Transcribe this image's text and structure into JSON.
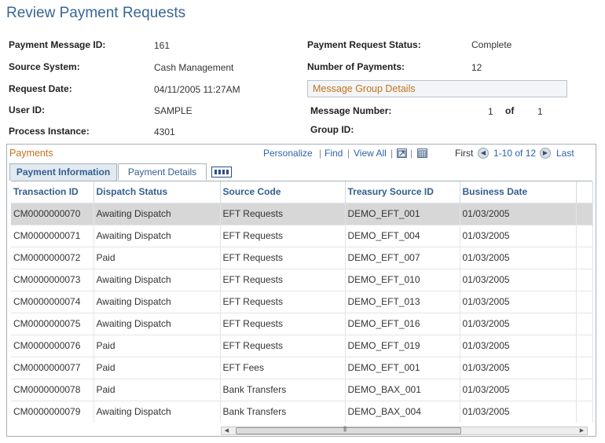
{
  "page": {
    "title": "Review Payment Requests"
  },
  "fields": {
    "payment_message_id": {
      "label": "Payment Message ID:",
      "value": "161"
    },
    "source_system": {
      "label": "Source System:",
      "value": "Cash Management"
    },
    "request_date": {
      "label": "Request Date:",
      "value": "04/11/2005 11:27AM"
    },
    "user_id": {
      "label": "User ID:",
      "value": "SAMPLE"
    },
    "process_instance": {
      "label": "Process Instance:",
      "value": "4301"
    },
    "payment_request_status": {
      "label": "Payment Request Status:",
      "value": "Complete"
    },
    "number_of_payments": {
      "label": "Number of Payments:",
      "value": "12"
    },
    "message_group_details": "Message Group Details",
    "message_number": {
      "label": "Message Number:",
      "value": "1",
      "of_label": "of",
      "of_value": "1"
    },
    "group_id": {
      "label": "Group ID:",
      "value": ""
    }
  },
  "grid": {
    "title": "Payments",
    "nav": {
      "personalize": "Personalize",
      "find": "Find",
      "view_all": "View All",
      "first": "First",
      "range": "1-10 of 12",
      "last": "Last",
      "sep": "|"
    },
    "tabs": [
      {
        "label": "Payment Information",
        "active": true
      },
      {
        "label": "Payment Details",
        "active": false
      }
    ],
    "columns": [
      "Transaction ID",
      "Dispatch Status",
      "Source Code",
      "Treasury Source ID",
      "Business Date"
    ],
    "rows": [
      [
        "CM0000000070",
        "Awaiting Dispatch",
        "EFT Requests",
        "DEMO_EFT_001",
        "01/03/2005"
      ],
      [
        "CM0000000071",
        "Awaiting Dispatch",
        "EFT Requests",
        "DEMO_EFT_004",
        "01/03/2005"
      ],
      [
        "CM0000000072",
        "Paid",
        "EFT Requests",
        "DEMO_EFT_007",
        "01/03/2005"
      ],
      [
        "CM0000000073",
        "Awaiting Dispatch",
        "EFT Requests",
        "DEMO_EFT_010",
        "01/03/2005"
      ],
      [
        "CM0000000074",
        "Awaiting Dispatch",
        "EFT Requests",
        "DEMO_EFT_013",
        "01/03/2005"
      ],
      [
        "CM0000000075",
        "Awaiting Dispatch",
        "EFT Requests",
        "DEMO_EFT_016",
        "01/03/2005"
      ],
      [
        "CM0000000076",
        "Paid",
        "EFT Requests",
        "DEMO_EFT_019",
        "01/03/2005"
      ],
      [
        "CM0000000077",
        "Paid",
        "EFT Fees",
        "DEMO_EFT_001",
        "01/03/2005"
      ],
      [
        "CM0000000078",
        "Paid",
        "Bank Transfers",
        "DEMO_BAX_001",
        "01/03/2005"
      ],
      [
        "CM0000000079",
        "Awaiting Dispatch",
        "Bank Transfers",
        "DEMO_BAX_004",
        "01/03/2005"
      ]
    ],
    "highlighted_row": 0
  },
  "colors": {
    "title": "#3a6596",
    "accent_orange": "#c3721c",
    "link": "#3163a6",
    "header_text": "#335e8e"
  },
  "icons": [
    "zoom-icon",
    "download-icon",
    "arrow-left-icon",
    "arrow-right-icon",
    "grid-view-icon",
    "scroll-left-icon",
    "scroll-right-icon"
  ]
}
